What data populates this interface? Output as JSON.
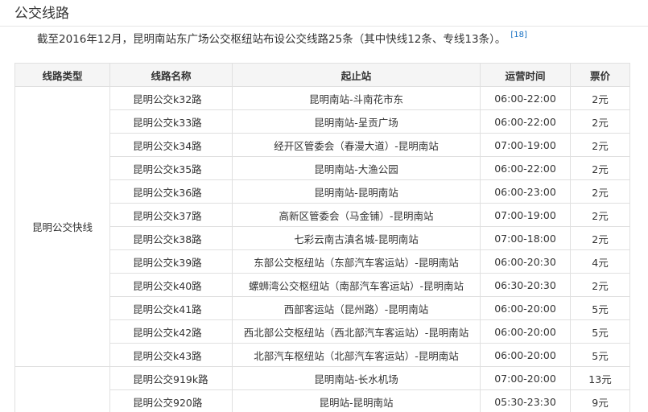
{
  "section": {
    "title": "公交线路",
    "intro": "截至2016年12月，昆明南站东广场公交枢纽站布设公交线路25条（其中快线12条、专线13条）。",
    "ref": "[18]"
  },
  "table": {
    "headers": [
      "线路类型",
      "线路名称",
      "起止站",
      "运营时间",
      "票价"
    ],
    "groups": [
      {
        "type": "昆明公交快线",
        "rows": [
          [
            "昆明公交k32路",
            "昆明南站-斗南花市东",
            "06:00-22:00",
            "2元"
          ],
          [
            "昆明公交k33路",
            "昆明南站-呈贡广场",
            "06:00-22:00",
            "2元"
          ],
          [
            "昆明公交k34路",
            "经开区管委会（春漫大道）-昆明南站",
            "07:00-19:00",
            "2元"
          ],
          [
            "昆明公交k35路",
            "昆明南站-大渔公园",
            "06:00-22:00",
            "2元"
          ],
          [
            "昆明公交k36路",
            "昆明南站-昆明南站",
            "06:00-23:00",
            "2元"
          ],
          [
            "昆明公交k37路",
            "高新区管委会（马金铺）-昆明南站",
            "07:00-19:00",
            "2元"
          ],
          [
            "昆明公交k38路",
            "七彩云南古滇名城-昆明南站",
            "07:00-18:00",
            "2元"
          ],
          [
            "昆明公交k39路",
            "东部公交枢纽站（东部汽车客运站）-昆明南站",
            "06:00-20:30",
            "4元"
          ],
          [
            "昆明公交k40路",
            "螺蛳湾公交枢纽站（南部汽车客运站）-昆明南站",
            "06:30-20:30",
            "2元"
          ],
          [
            "昆明公交k41路",
            "西部客运站（昆州路）-昆明南站",
            "06:00-20:00",
            "5元"
          ],
          [
            "昆明公交k42路",
            "西北部公交枢纽站（西北部汽车客运站）-昆明南站",
            "06:00-20:00",
            "5元"
          ],
          [
            "昆明公交k43路",
            "北部汽车枢纽站（北部汽车客运站）-昆明南站",
            "06:00-20:00",
            "5元"
          ]
        ]
      },
      {
        "type": "",
        "rows": [
          [
            "昆明公交919k路",
            "昆明南站-长水机场",
            "07:00-20:00",
            "13元"
          ],
          [
            "昆明公交920路",
            "昆明站-昆明南站",
            "05:30-23:30",
            "9元"
          ]
        ]
      }
    ]
  }
}
